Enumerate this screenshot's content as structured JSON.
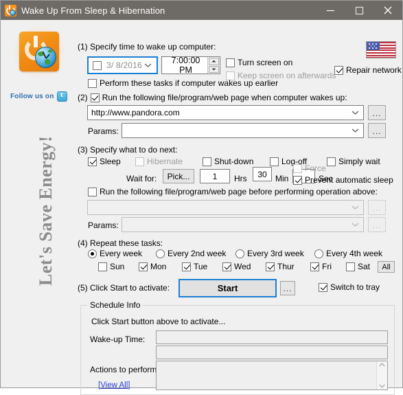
{
  "window": {
    "title": "Wake Up From Sleep & Hibernation",
    "icon": "app-clock-globe-icon",
    "controls": {
      "minimize": "—",
      "maximize": "□",
      "close": "✕"
    }
  },
  "branding": {
    "logo_icon": "power-clock-globe-logo",
    "follow_text": "Follow us on",
    "twitter_icon": "twitter-icon",
    "slogan": "Let's Save Energy!",
    "flag_icon": "us-flag-icon"
  },
  "step1": {
    "label": "(1) Specify time to wake up computer:",
    "date_enabled": false,
    "date_value": "3/ 8/2016",
    "time_value": "7:00:00 PM",
    "turn_screen_on": {
      "label": "Turn screen on",
      "checked": false,
      "disabled": false
    },
    "keep_screen_on": {
      "label": "Keep screen on afterwards",
      "checked": false,
      "disabled": true
    },
    "repair_network": {
      "label": "Repair network",
      "checked": true,
      "disabled": false
    },
    "perform_earlier": {
      "label": "Perform these tasks if computer wakes up earlier",
      "checked": false,
      "disabled": false
    }
  },
  "step2": {
    "label": "(2) Run the following file/program/web page when computer wakes up:",
    "checked": true,
    "url_value": "http://www.pandora.com",
    "url_placeholder": "",
    "params_label": "Params:",
    "params_value": "",
    "browse_label": "...",
    "params_browse_label": "..."
  },
  "step3": {
    "label": "(3) Specify what to do next:",
    "actions": [
      {
        "label": "Sleep",
        "checked": true,
        "disabled": false
      },
      {
        "label": "Hibernate",
        "checked": false,
        "disabled": true
      },
      {
        "label": "Shut-down",
        "checked": false,
        "disabled": false
      },
      {
        "label": "Log-off",
        "checked": false,
        "disabled": false
      },
      {
        "label": "Simply wait",
        "checked": false,
        "disabled": false
      }
    ],
    "wait_for_label": "Wait for:",
    "pick_label": "Pick...",
    "hours_value": "1",
    "hours_unit": "Hrs",
    "minutes_value": "30",
    "minutes_unit": "Min",
    "seconds_value": "",
    "seconds_unit": "Sec",
    "force": {
      "label": "Force",
      "checked": false,
      "disabled": true
    },
    "prevent_sleep": {
      "label": "Prevent automatic sleep",
      "checked": true,
      "disabled": false
    },
    "pre_run": {
      "label": "Run the following file/program/web page before performing operation above:",
      "checked": false
    },
    "pre_url_value": "",
    "pre_params_label": "Params:",
    "pre_params_value": "",
    "pre_browse_label": "...",
    "pre_params_browse_label": "..."
  },
  "step4": {
    "label": "(4) Repeat these tasks:",
    "intervals": [
      {
        "label": "Every week",
        "selected": true
      },
      {
        "label": "Every 2nd week",
        "selected": false
      },
      {
        "label": "Every 3rd week",
        "selected": false
      },
      {
        "label": "Every 4th week",
        "selected": false
      }
    ],
    "days": [
      {
        "label": "Sun",
        "checked": false
      },
      {
        "label": "Mon",
        "checked": true
      },
      {
        "label": "Tue",
        "checked": true
      },
      {
        "label": "Wed",
        "checked": true
      },
      {
        "label": "Thur",
        "checked": true
      },
      {
        "label": "Fri",
        "checked": true
      },
      {
        "label": "Sat",
        "checked": false
      }
    ],
    "all_label": "All"
  },
  "step5": {
    "label": "(5) Click Start to activate:",
    "start_label": "Start",
    "options_label": "...",
    "switch_to_tray": {
      "label": "Switch to tray",
      "checked": true
    }
  },
  "schedule_info": {
    "group_title": "Schedule Info",
    "status_text": "Click Start button above to activate...",
    "wakeup_label": "Wake-up Time:",
    "wakeup_value": "",
    "wakeup_value2": "",
    "actions_label": "Actions to perform:",
    "actions_value": "",
    "view_all_label": "[View All]"
  }
}
